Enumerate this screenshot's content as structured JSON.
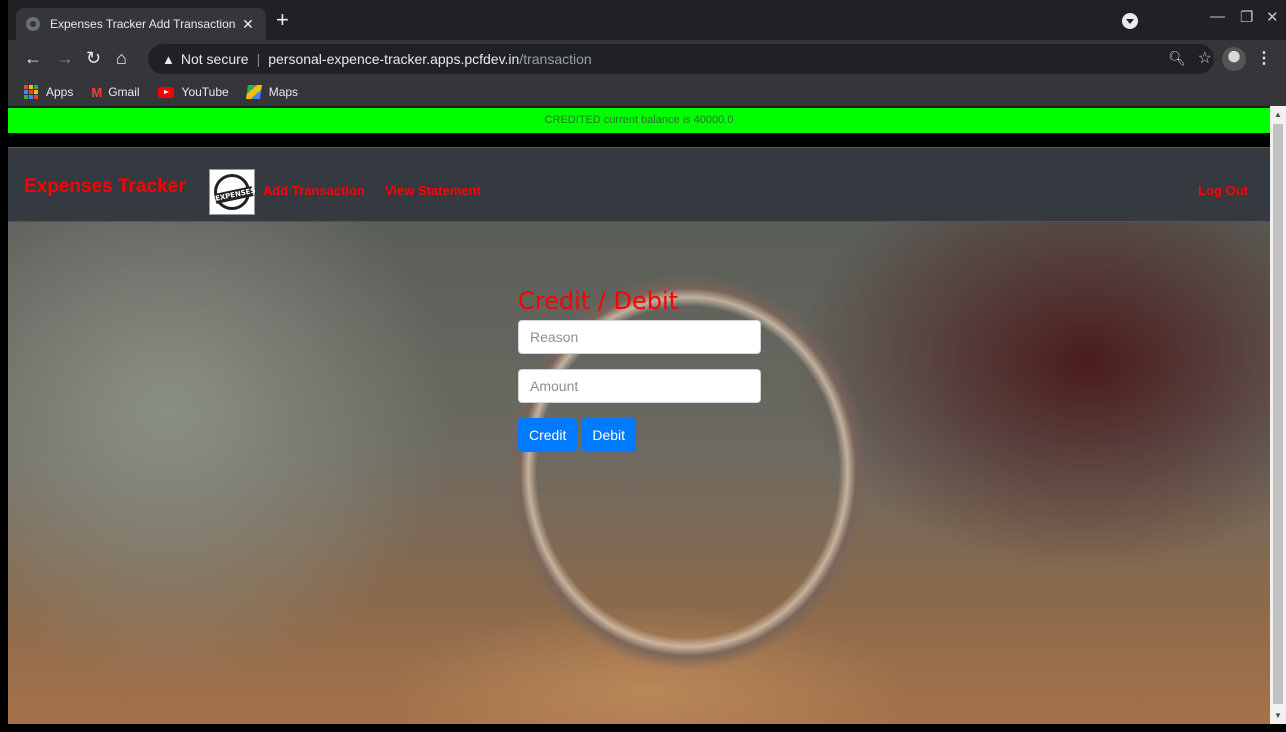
{
  "browser": {
    "tab_title": "Expenses Tracker Add Transaction",
    "tab_close": "✕",
    "new_tab": "+",
    "not_secure": "Not secure",
    "url_host": "personal-expence-tracker.apps.pcfdev.in",
    "url_path": "/transaction",
    "bookmarks": [
      "Apps",
      "Gmail",
      "YouTube",
      "Maps"
    ]
  },
  "alert": {
    "text": "CREDITED current balance is 40000.0",
    "color": "#00ff00"
  },
  "navbar": {
    "brand": "Expenses Tracker",
    "logo_text": "EXPENSES",
    "links": [
      "Add Transaction",
      "View Statement"
    ],
    "logout": "Log Out",
    "accent": "#ff0000"
  },
  "form": {
    "title": "Credit / Debit",
    "reason_placeholder": "Reason",
    "amount_placeholder": "Amount",
    "credit_label": "Credit",
    "debit_label": "Debit",
    "button_color": "#007bff"
  }
}
